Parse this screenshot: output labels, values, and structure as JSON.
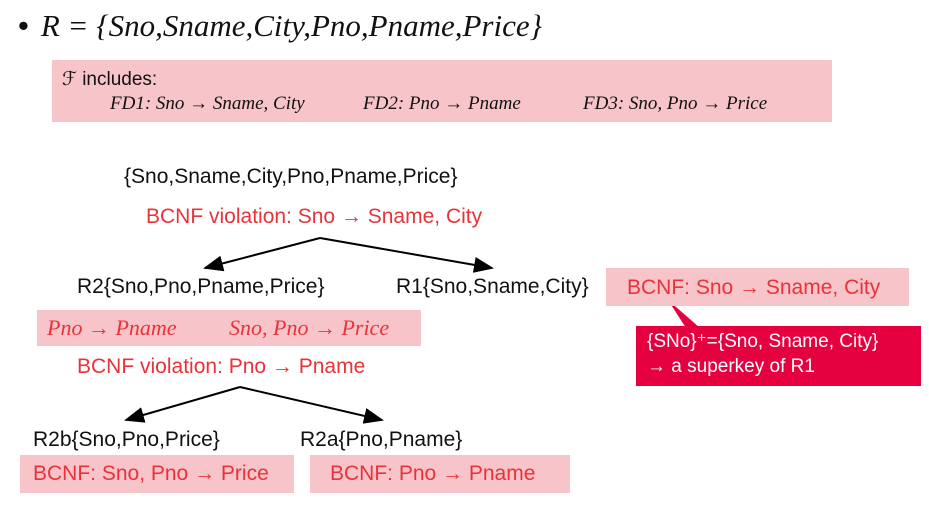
{
  "title": {
    "bullet": "•",
    "text": "R = {Sno,Sname,City,Pno,Pname,Price}"
  },
  "fds": {
    "label": "ℱ includes:",
    "fd1": "FD1: Sno → Sname, City",
    "fd2": "FD2: Pno  → Pname",
    "fd3": "FD3: Sno, Pno  → Price"
  },
  "root": {
    "relation": "{Sno,Sname,City,Pno,Pname,Price}",
    "violation": "BCNF violation: Sno → Sname, City"
  },
  "r2": {
    "relation": "R2{Sno,Pno,Pname,Price}",
    "fd1": "Pno → Pname",
    "fd2": "Sno, Pno → Price",
    "violation": "BCNF violation: Pno → Pname"
  },
  "r1": {
    "relation": "R1{Sno,Sname,City}",
    "bcnf": "BCNF: Sno → Sname, City",
    "callout_line1": "{SNo}⁺={Sno, Sname, City}",
    "callout_line2": "→ a superkey of R1"
  },
  "r2b": {
    "relation": "R2b{Sno,Pno,Price}",
    "bcnf": "BCNF: Sno, Pno → Price"
  },
  "r2a": {
    "relation": "R2a{Pno,Pname}",
    "bcnf": "BCNF: Pno → Pname"
  },
  "colors": {
    "accent_red": "#e8333a",
    "box_pink": "#f7c4c9",
    "callout_red": "#e5003f"
  }
}
